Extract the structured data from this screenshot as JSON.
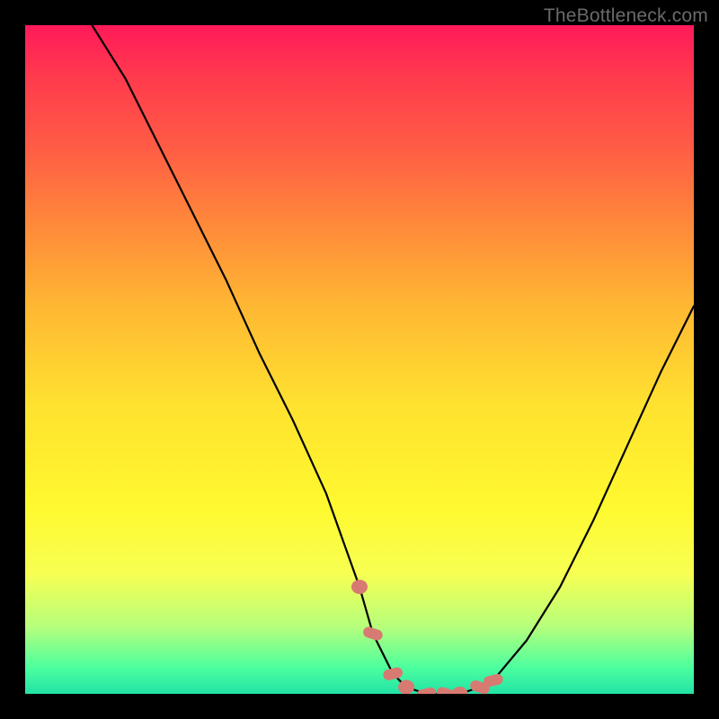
{
  "attribution": "TheBottleneck.com",
  "chart_data": {
    "type": "line",
    "title": "",
    "xlabel": "",
    "ylabel": "",
    "xlim": [
      0,
      100
    ],
    "ylim": [
      0,
      100
    ],
    "grid": false,
    "legend": false,
    "series": [
      {
        "name": "curve",
        "color": "#000000",
        "x": [
          10,
          15,
          20,
          25,
          30,
          35,
          40,
          45,
          50,
          52,
          55,
          57,
          60,
          63,
          65,
          68,
          70,
          75,
          80,
          85,
          90,
          95,
          100
        ],
        "y": [
          100,
          92,
          82,
          72,
          62,
          51,
          41,
          30,
          16,
          9,
          3,
          1,
          0,
          0,
          0,
          1,
          2,
          8,
          16,
          26,
          37,
          48,
          58
        ]
      }
    ],
    "annotations": [
      {
        "name": "flat-zone-marker",
        "type": "scatter",
        "color": "#d77a72",
        "x": [
          50,
          52,
          55,
          57,
          60,
          63,
          65,
          68,
          70
        ],
        "y": [
          16,
          9,
          3,
          1,
          0,
          0,
          0,
          1,
          2
        ],
        "style": "irregular-dots"
      }
    ],
    "background_gradient": {
      "stops": [
        {
          "pos": 0.0,
          "color": "#ff1a5a"
        },
        {
          "pos": 0.3,
          "color": "#ff8a3a"
        },
        {
          "pos": 0.6,
          "color": "#ffe22f"
        },
        {
          "pos": 0.85,
          "color": "#f7ff52"
        },
        {
          "pos": 1.0,
          "color": "#22e3a6"
        }
      ],
      "direction": "top-to-bottom"
    }
  }
}
